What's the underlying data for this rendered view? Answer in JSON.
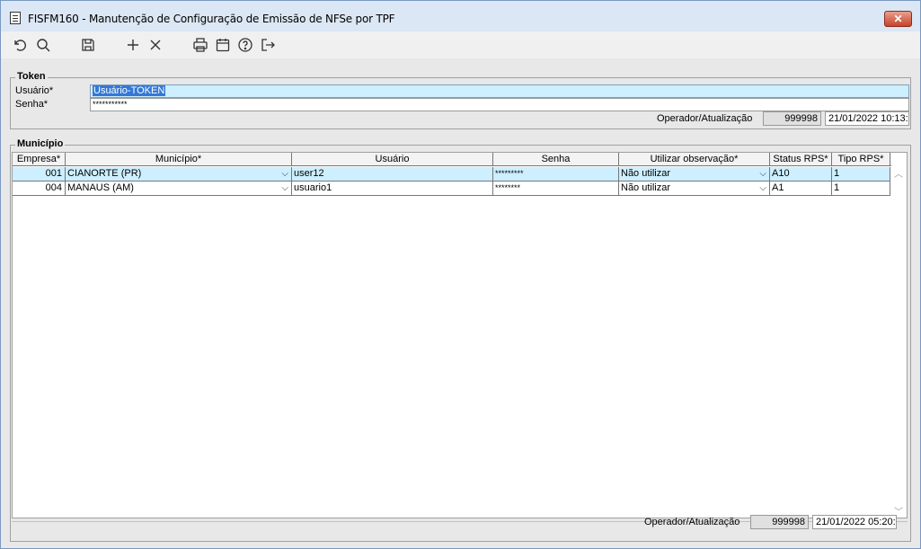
{
  "window": {
    "title": "FISFM160 - Manutenção de Configuração de Emissão de NFSe por TPF",
    "close_label": "✕"
  },
  "toolbar": {
    "icons": [
      "undo-icon",
      "search-icon",
      "save-icon",
      "add-icon",
      "delete-icon",
      "print-icon",
      "calendar-icon",
      "help-icon",
      "exit-icon"
    ]
  },
  "token": {
    "legend": "Token",
    "usuario_label": "Usuário*",
    "usuario_value": "Usuário-TOKEN",
    "senha_label": "Senha*",
    "senha_value": "***********",
    "operador_label": "Operador/Atualização",
    "operador_value": "999998",
    "atualizacao_value": "21/01/2022 10:13:"
  },
  "municipio": {
    "legend": "Município",
    "columns": [
      "Empresa*",
      "Município*",
      "Usuário",
      "Senha",
      "Utilizar observação*",
      "Status RPS*",
      "Tipo RPS*"
    ],
    "rows": [
      {
        "empresa": "001",
        "municipio": "CIANORTE (PR)",
        "usuario": "user12",
        "senha": "*********",
        "observacao": "Não utilizar",
        "status_rps": "A10",
        "tipo_rps": "1"
      },
      {
        "empresa": "004",
        "municipio": "MANAUS (AM)",
        "usuario": "usuario1",
        "senha": "********",
        "observacao": "Não utilizar",
        "status_rps": "A1",
        "tipo_rps": "1"
      }
    ],
    "operador_label": "Operador/Atualização",
    "operador_value": "999998",
    "atualizacao_value": "21/01/2022 05:20:"
  }
}
